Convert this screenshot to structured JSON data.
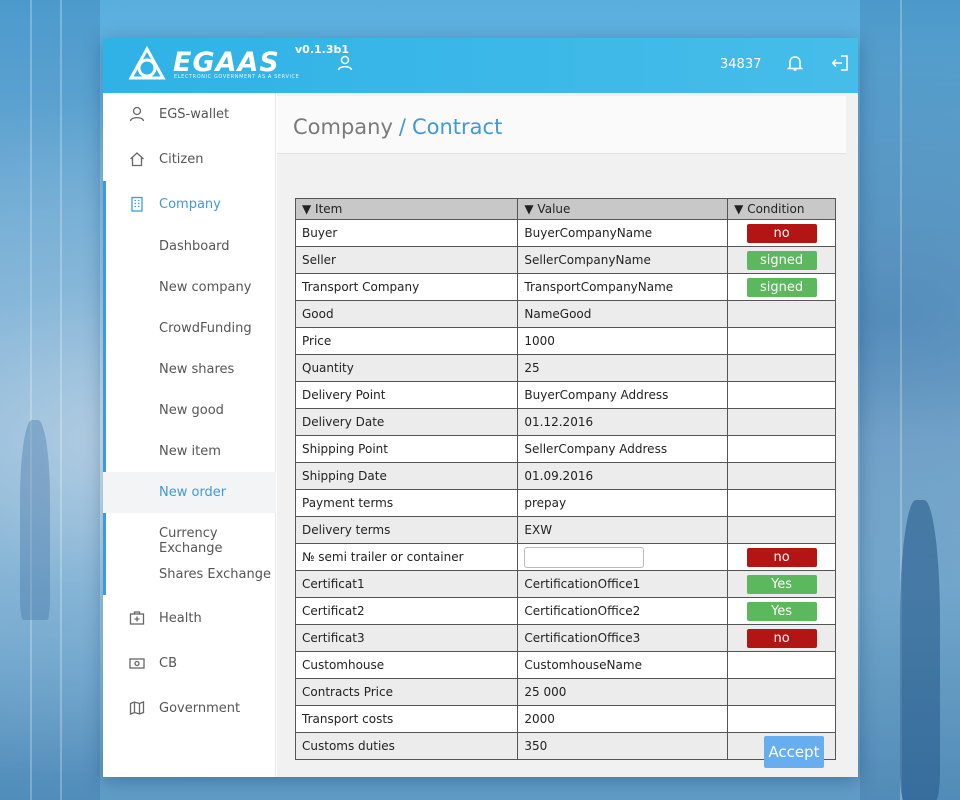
{
  "app": {
    "brand": "EGAAS",
    "brand_sub": "ELECTRONIC GOVERNMENT AS A SERVICE",
    "version": "v0.1.3b1",
    "balance": "34837"
  },
  "sidebar": {
    "items": [
      {
        "label": "EGS-wallet",
        "icon": "user-icon"
      },
      {
        "label": "Citizen",
        "icon": "home-icon"
      },
      {
        "label": "Company",
        "icon": "building-icon"
      },
      {
        "label": "Health",
        "icon": "medkit-icon"
      },
      {
        "label": "CB",
        "icon": "banknote-icon"
      },
      {
        "label": "Government",
        "icon": "map-icon"
      }
    ],
    "company_submenu": [
      "Dashboard",
      "New company",
      "CrowdFunding",
      "New shares",
      "New good",
      "New item",
      "New order",
      "Currency Exchange",
      "Shares Exchange"
    ],
    "selected": "New order"
  },
  "breadcrumb": {
    "section": "Company",
    "separator": "/",
    "page": "Contract"
  },
  "table": {
    "headers": [
      "▼ Item",
      "▼ Value",
      "▼ Condition"
    ],
    "rows": [
      {
        "item": "Buyer",
        "value": "BuyerCompanyName",
        "condition": "no"
      },
      {
        "item": "Seller",
        "value": "SellerCompanyName",
        "condition": "signed"
      },
      {
        "item": "Transport Company",
        "value": "TransportCompanyName",
        "condition": "signed"
      },
      {
        "item": "Good",
        "value": "NameGood",
        "condition": ""
      },
      {
        "item": "Price",
        "value": "1000",
        "condition": ""
      },
      {
        "item": "Quantity",
        "value": "25",
        "condition": ""
      },
      {
        "item": "Delivery Point",
        "value": "BuyerCompany Address",
        "condition": ""
      },
      {
        "item": "Delivery Date",
        "value": "01.12.2016",
        "condition": ""
      },
      {
        "item": "Shipping Point",
        "value": "SellerCompany Address",
        "condition": ""
      },
      {
        "item": "Shipping Date",
        "value": "01.09.2016",
        "condition": ""
      },
      {
        "item": "Payment terms",
        "value": "prepay",
        "condition": ""
      },
      {
        "item": "Delivery terms",
        "value": "EXW",
        "condition": ""
      },
      {
        "item": "№ semi trailer or container",
        "value": "",
        "condition": "no",
        "input": true
      },
      {
        "item": "Certificat1",
        "value": "CertificationOffice1",
        "condition": "Yes"
      },
      {
        "item": "Certificat2",
        "value": "CertificationOffice2",
        "condition": "Yes"
      },
      {
        "item": "Certificat3",
        "value": "CertificationOffice3",
        "condition": "no"
      },
      {
        "item": "Customhouse",
        "value": "CustomhouseName",
        "condition": ""
      },
      {
        "item": "Contracts Price",
        "value": "25 000",
        "condition": ""
      },
      {
        "item": "Transport costs",
        "value": "2000",
        "condition": ""
      },
      {
        "item": "Customs duties",
        "value": "350",
        "condition": ""
      }
    ]
  },
  "actions": {
    "accept_label": "Accept"
  },
  "colors": {
    "topbar": "#2fb2e6",
    "accent": "#3e9ad8",
    "badge_no": "#b31414",
    "badge_ok": "#5bb85d",
    "accept": "#66aef0"
  }
}
